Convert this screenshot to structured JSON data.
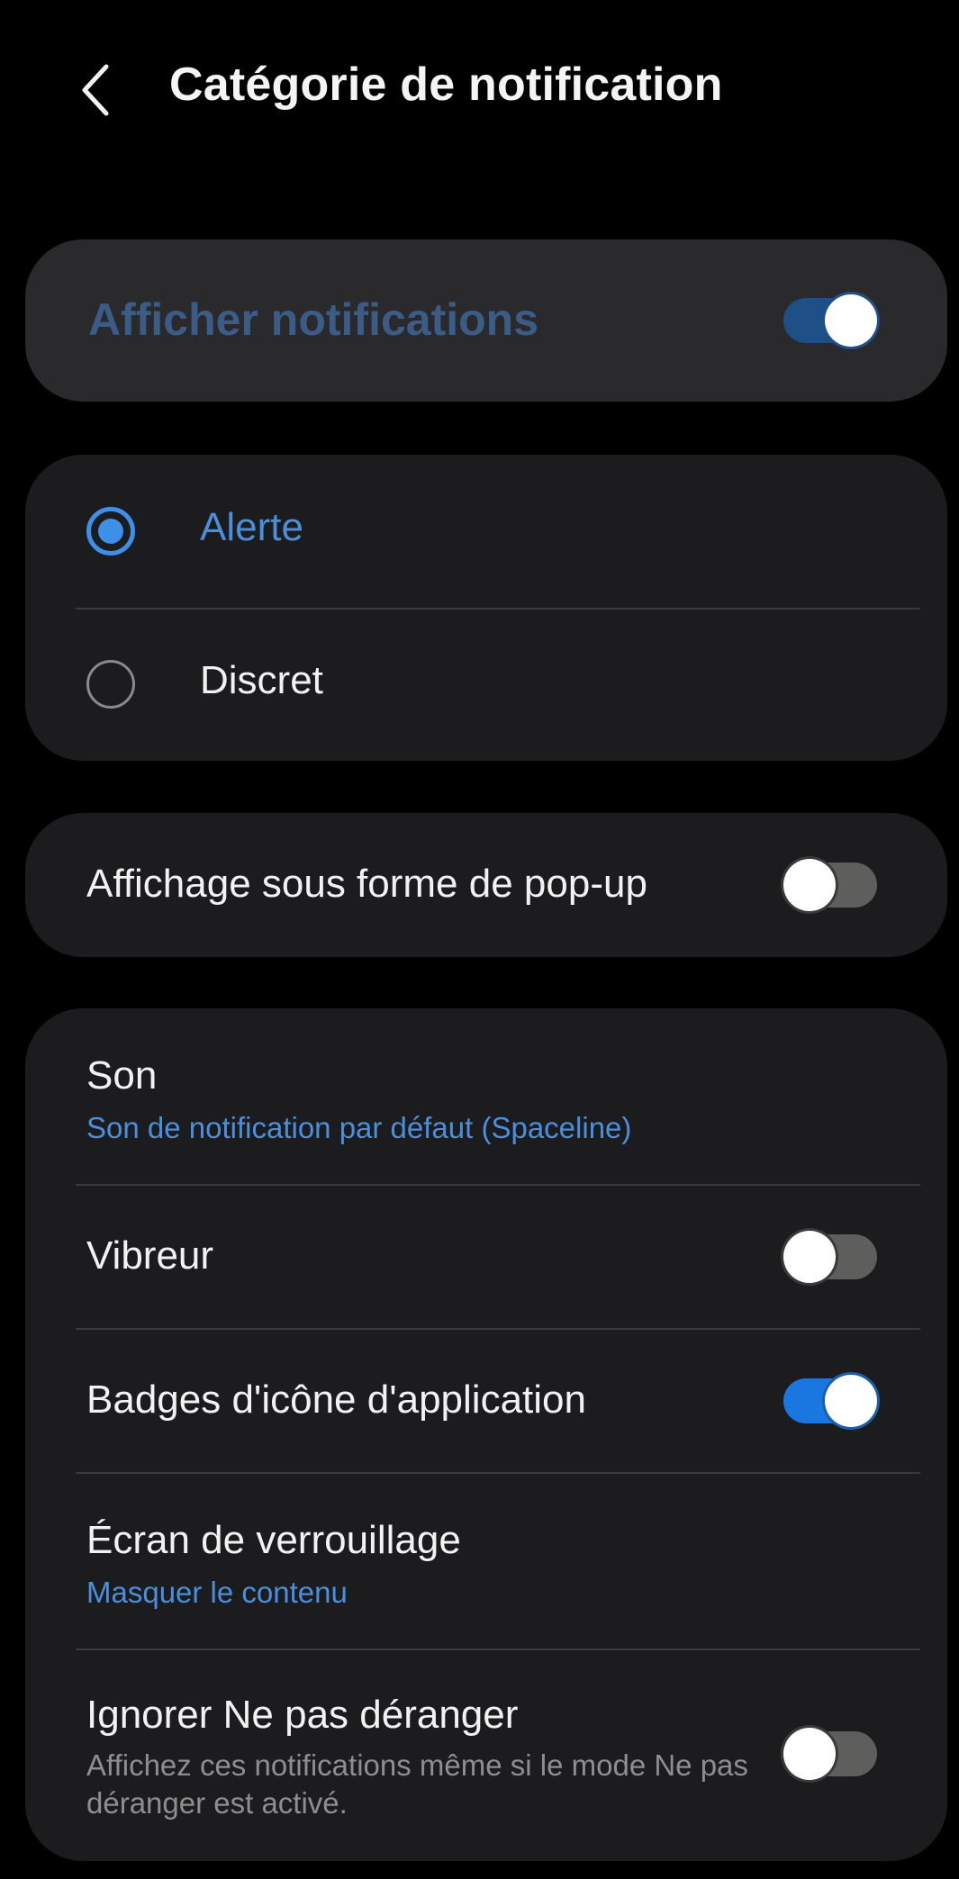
{
  "header": {
    "title": "Catégorie de notification",
    "back_icon": "chevron-left-icon"
  },
  "master_toggle": {
    "label": "Afficher notifications",
    "state": "on"
  },
  "alert_style": {
    "options": [
      {
        "label": "Alerte",
        "selected": true
      },
      {
        "label": "Discret",
        "selected": false
      }
    ]
  },
  "popup": {
    "label": "Affichage sous forme de pop-up",
    "state": "off"
  },
  "settings": {
    "sound": {
      "title": "Son",
      "value": "Son de notification par défaut (Spaceline)"
    },
    "vibrate": {
      "title": "Vibreur",
      "state": "off"
    },
    "badges": {
      "title": "Badges d'icône d'application",
      "state": "on"
    },
    "lockscreen": {
      "title": "Écran de verrouillage",
      "value": "Masquer le contenu"
    },
    "dnd": {
      "title": "Ignorer Ne pas déranger",
      "description": "Affichez ces notifications même si le mode Ne pas déranger est activé.",
      "state": "off"
    }
  },
  "colors": {
    "background": "#000000",
    "card": "#1c1c1e",
    "accent": "#3d8fe8",
    "toggle_on": "#1a76e0",
    "toggle_off_track": "#5e5e5c",
    "secondary_text": "#8e8e8e"
  }
}
